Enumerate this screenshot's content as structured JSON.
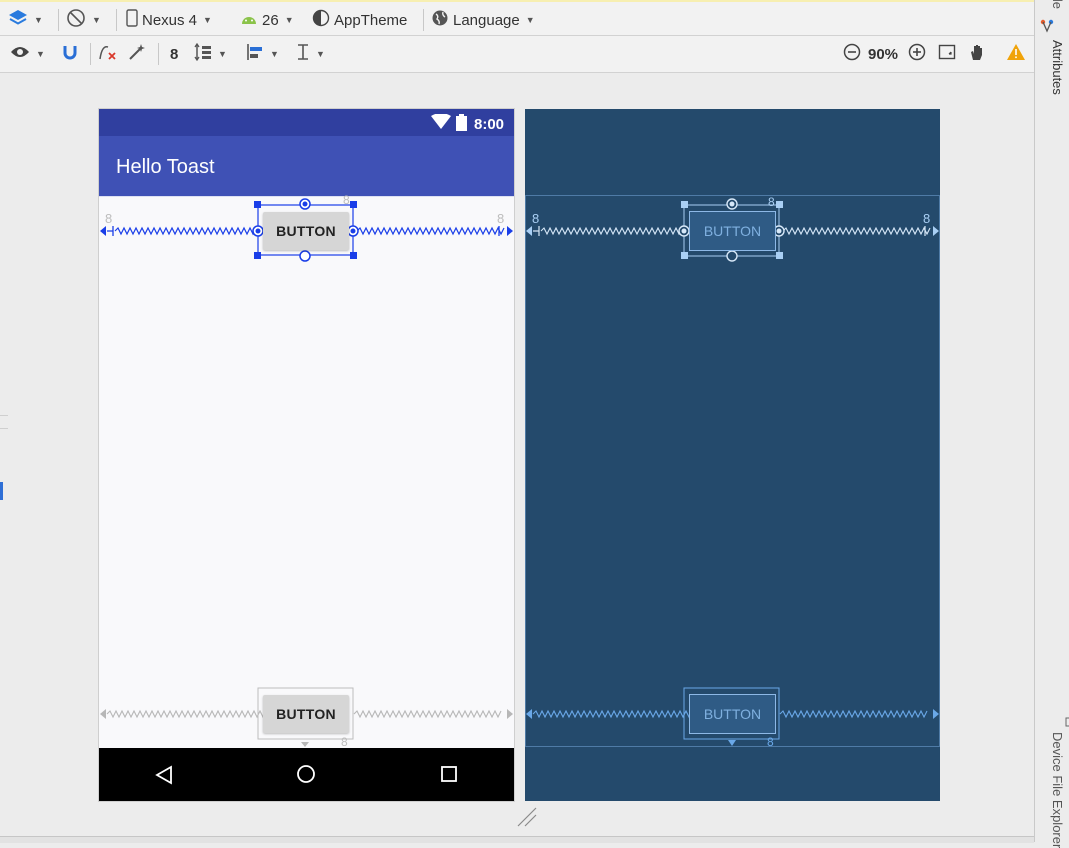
{
  "toolbar_top": {
    "design_mode": "layers-icon",
    "orientation": "rotate-icon",
    "device": "Nexus 4",
    "api_level": "26",
    "theme": "AppTheme",
    "language": "Language"
  },
  "toolbar_second": {
    "margin_default": "8",
    "zoom": "90%"
  },
  "right_panel": {
    "attributes_label": "Attributes",
    "palette_top": "Gradle",
    "device_explorer": "Device File Explorer"
  },
  "design_preview": {
    "status_time": "8:00",
    "app_title": "Hello Toast",
    "button_top_label": "BUTTON",
    "button_bottom_label": "BUTTON",
    "margin_left": "8",
    "margin_right": "8",
    "margin_top": "8",
    "margin_bottom": "8"
  },
  "blueprint_preview": {
    "button_top_label": "BUTTON",
    "button_bottom_label": "BUTTON",
    "margin_left": "8",
    "margin_right": "8",
    "margin_top": "8",
    "margin_bottom": "8"
  },
  "colors": {
    "primary": "#3f51b5",
    "primary_dark": "#303f9f",
    "blueprint_bg": "#244a6c",
    "selection_blue": "#1a3ee8",
    "warning": "#f0a30a"
  }
}
